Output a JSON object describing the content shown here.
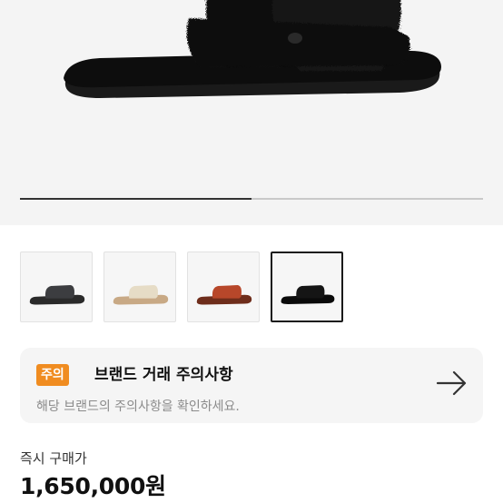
{
  "gallery": {
    "progress": 0.5,
    "thumbnails": [
      {
        "name": "thumb-slide-grey",
        "color": "#3c3d40",
        "sole": "#2a2a2a",
        "selected": false
      },
      {
        "name": "thumb-slide-cream",
        "color": "#e6dcc6",
        "sole": "#c8a985",
        "selected": false
      },
      {
        "name": "thumb-slide-rust",
        "color": "#b7472a",
        "sole": "#6e2d1b",
        "selected": false
      },
      {
        "name": "thumb-slide-black",
        "color": "#151515",
        "sole": "#0a0a0a",
        "selected": true
      }
    ]
  },
  "notice": {
    "badge": "주의",
    "title": "브랜드 거래 주의사항",
    "subtitle": "해당 브랜드의 주의사항을 확인하세요."
  },
  "price": {
    "label": "즉시 구매가",
    "value": "1,650,000원"
  },
  "colors": {
    "badge": "#f08c20",
    "hero_bg": "#f4f4f4",
    "card_bg": "#f5f5f5"
  }
}
